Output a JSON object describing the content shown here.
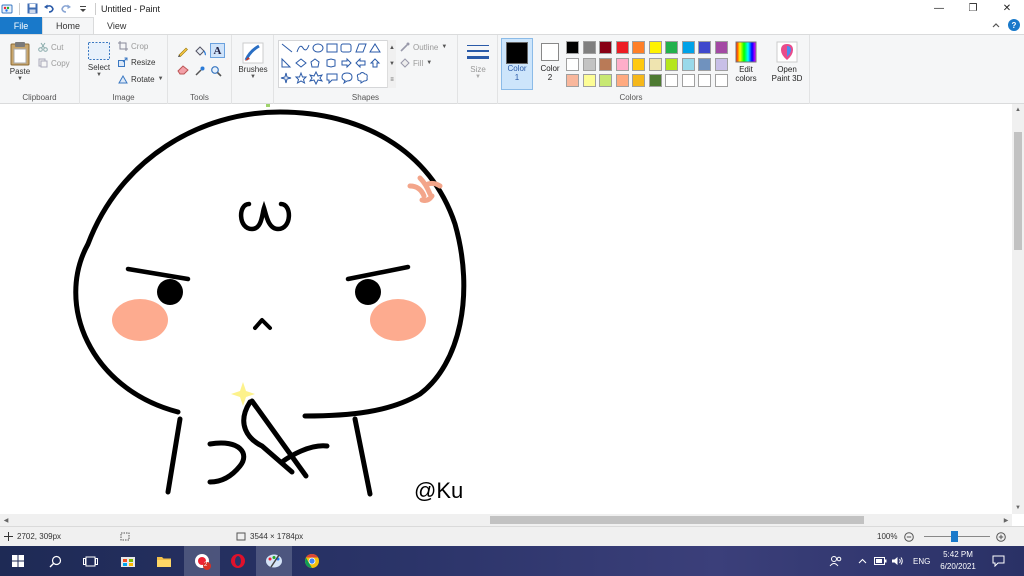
{
  "window": {
    "title": "Untitled - Paint",
    "controls": {
      "minimize": "—",
      "restore": "❐",
      "close": "✕"
    }
  },
  "tabs": {
    "file": "File",
    "home": "Home",
    "view": "View"
  },
  "ribbon": {
    "clipboard": {
      "label": "Clipboard",
      "paste": "Paste",
      "cut": "Cut",
      "copy": "Copy"
    },
    "image": {
      "label": "Image",
      "select": "Select",
      "crop": "Crop",
      "resize": "Resize",
      "rotate": "Rotate"
    },
    "tools": {
      "label": "Tools"
    },
    "brushes": {
      "label": "Brushes"
    },
    "shapes": {
      "label": "Shapes",
      "outline": "Outline",
      "fill": "Fill"
    },
    "size": {
      "label": "Size"
    },
    "colors": {
      "label": "Colors",
      "color1_label": "Color",
      "color1_num": "1",
      "color2_label": "Color",
      "color2_num": "2",
      "color1_value": "#000000",
      "color2_value": "#ffffff",
      "edit_colors_line1": "Edit",
      "edit_colors_line2": "colors",
      "palette": [
        "#000000",
        "#7f7f7f",
        "#880015",
        "#ed1c24",
        "#ff7f27",
        "#fff200",
        "#22b14c",
        "#00a2e8",
        "#3f48cc",
        "#a349a4",
        "#ffffff",
        "#c3c3c3",
        "#b97a57",
        "#ffaec9",
        "#ffc90e",
        "#efe4b0",
        "#b5e61d",
        "#99d9ea",
        "#7092be",
        "#c8bfe7",
        "#f9b79c",
        "#fdfd96",
        "#c7e873",
        "#ffaa80",
        "#f5b71a",
        "#4d7a32",
        "#ffffff",
        "#ffffff",
        "#ffffff",
        "#ffffff"
      ]
    },
    "paint3d": {
      "line1": "Open",
      "line2": "Paint 3D"
    }
  },
  "canvas": {
    "signature": "@Ku"
  },
  "statusbar": {
    "cursor_pos": "2702, 309px",
    "image_size": "3544 × 1784px",
    "zoom": "100%"
  },
  "taskbar": {
    "lang": "ENG",
    "time": "5:42 PM",
    "date": "6/20/2021",
    "badge": "2"
  }
}
